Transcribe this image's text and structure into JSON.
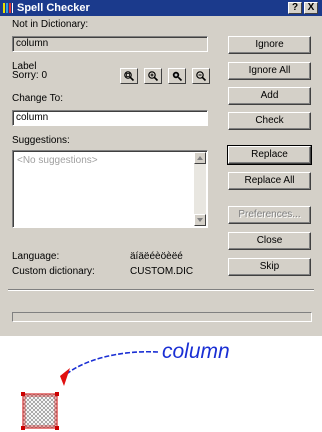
{
  "window": {
    "title": "Spell Checker",
    "help_label": "?",
    "close_label": "X"
  },
  "not_in_dictionary": {
    "label": "Not in Dictionary:",
    "value": "column"
  },
  "label_row": {
    "label": "Label",
    "sort_label": "Sorry: 0"
  },
  "zoom_icons": [
    "zoom-to-fit-icon",
    "zoom-in-icon",
    "zoom-in-more-icon",
    "zoom-out-icon"
  ],
  "change_to": {
    "label": "Change To:",
    "value": "column"
  },
  "suggestions": {
    "label": "Suggestions:",
    "items": [
      "<No suggestions>"
    ]
  },
  "language": {
    "label": "Language:",
    "value": "äíäëéèöèëé"
  },
  "custom_dictionary": {
    "label": "Custom dictionary:",
    "value": "CUSTOM.DIC"
  },
  "buttons": {
    "ignore": "Ignore",
    "ignore_all": "Ignore All",
    "add": "Add",
    "check": "Check",
    "replace": "Replace",
    "replace_all": "Replace All",
    "preferences": "Preferences...",
    "close": "Close",
    "skip": "Skip"
  },
  "annotation": {
    "text": "column"
  },
  "colors": {
    "titlebar": "#1b3a8c",
    "dialog_face": "#d4d0c8",
    "annotation_blue": "#1a2fd4",
    "annotation_arrow": "#e01010",
    "element_outline": "#cc0000"
  }
}
